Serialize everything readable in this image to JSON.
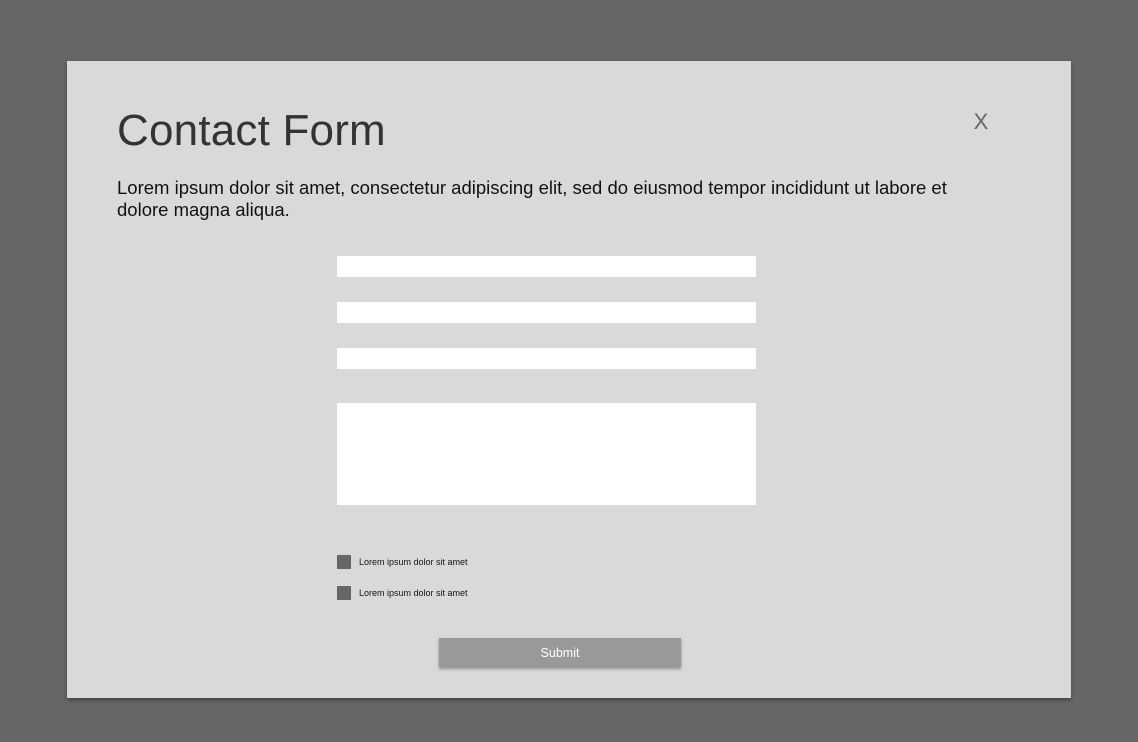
{
  "modal": {
    "title": "Contact Form",
    "close_label": "X",
    "description": "Lorem ipsum dolor sit amet, consectetur adipiscing elit, sed do eiusmod tempor incididunt ut labore et dolore magna aliqua."
  },
  "form": {
    "fields": [
      {
        "value": "",
        "placeholder": ""
      },
      {
        "value": "",
        "placeholder": ""
      },
      {
        "value": "",
        "placeholder": ""
      }
    ],
    "message": {
      "value": "",
      "placeholder": ""
    },
    "checkboxes": [
      {
        "label": "Lorem ipsum dolor sit amet",
        "checked": false
      },
      {
        "label": "Lorem ipsum dolor sit amet",
        "checked": false
      }
    ],
    "submit_label": "Submit"
  },
  "colors": {
    "overlay": "#666666",
    "modal_background": "#d9d9d9",
    "input_background": "#ffffff",
    "checkbox": "#666666",
    "button_background": "#999999",
    "button_text": "#ffffff",
    "title_text": "#333333"
  }
}
